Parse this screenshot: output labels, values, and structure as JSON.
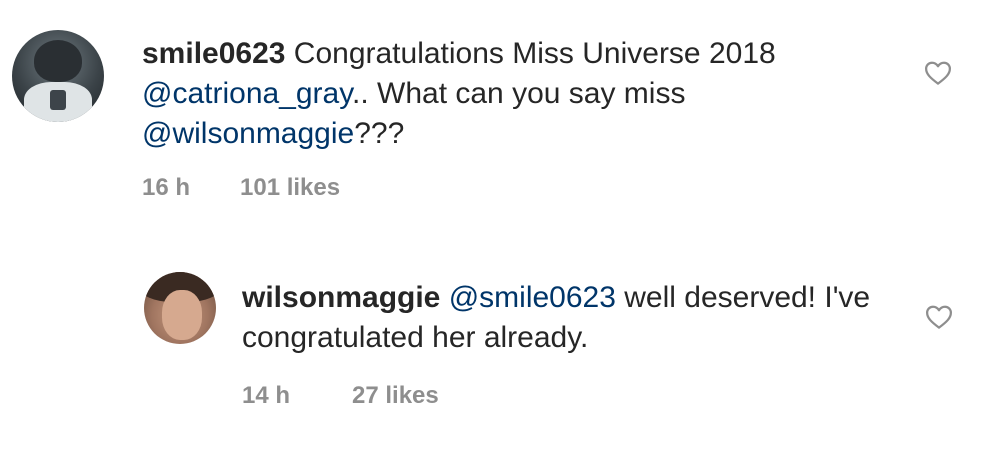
{
  "comments": [
    {
      "username": "smile0623",
      "text_prefix": " Congratulations Miss Universe 2018 ",
      "mention_1": "@catriona_gray",
      "text_middle": ".. What can you say miss ",
      "mention_2": "@wilsonmaggie",
      "text_suffix": "???",
      "time": "16 h",
      "likes": "101 likes"
    }
  ],
  "reply": {
    "username": "wilsonmaggie",
    "mention": "@smile0623",
    "text": " well deserved! I've congratulated her already.",
    "time": "14 h",
    "likes": "27 likes"
  },
  "icons": {
    "like": "heart-outline-icon"
  }
}
